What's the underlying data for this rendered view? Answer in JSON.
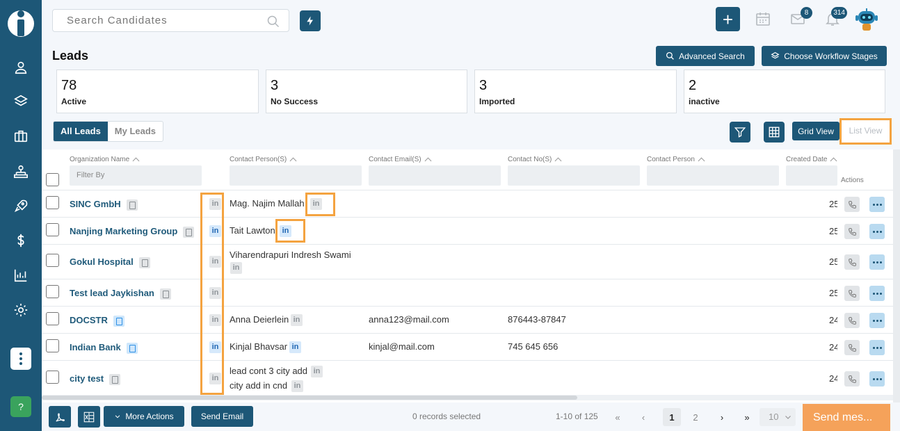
{
  "topbar": {
    "search_placeholder": "Search Candidates",
    "mail_badge": "8",
    "bell_badge": "314"
  },
  "page": {
    "title": "Leads",
    "advanced_search_label": "Advanced Search",
    "workflow_label": "Choose Workflow Stages"
  },
  "stats": [
    {
      "value": "78",
      "label": "Active"
    },
    {
      "value": "3",
      "label": "No Success"
    },
    {
      "value": "3",
      "label": "Imported"
    },
    {
      "value": "2",
      "label": "inactive"
    }
  ],
  "tabs": {
    "all": "All Leads",
    "mine": "My Leads"
  },
  "views": {
    "grid": "Grid View",
    "list": "List View"
  },
  "table": {
    "headers": {
      "org": "Organization Name",
      "contacts": "Contact Person(S)",
      "email": "Contact Email(S)",
      "phone": "Contact No(S)",
      "person": "Contact Person",
      "created": "Created Date",
      "actions": "Actions"
    },
    "filter_placeholder": "Filter By",
    "rows": [
      {
        "org": "SINC GmbH",
        "contact1": "Mag. Najim Mallah",
        "contact2": "",
        "email": "",
        "phone": "",
        "date": "25"
      },
      {
        "org": "Nanjing Marketing Group",
        "contact1": "Tait Lawton",
        "contact2": "",
        "email": "",
        "phone": "",
        "date": "25"
      },
      {
        "org": "Gokul Hospital",
        "contact1": "Viharendrapuri Indresh Swami",
        "contact2": "",
        "email": "",
        "phone": "",
        "date": "25"
      },
      {
        "org": "Test lead Jaykishan",
        "contact1": "",
        "contact2": "",
        "email": "",
        "phone": "",
        "date": "25"
      },
      {
        "org": "DOCSTR",
        "contact1": "Anna Deierlein",
        "contact2": "",
        "email": "anna123@mail.com",
        "phone": "876443-87847",
        "date": "24"
      },
      {
        "org": "Indian Bank",
        "contact1": "Kinjal Bhavsar",
        "contact2": "",
        "email": "kinjal@mail.com",
        "phone": "745 645 656",
        "date": "24"
      },
      {
        "org": "city test",
        "contact1": "lead cont 3 city add",
        "contact2": "city add in cnd",
        "email": "",
        "phone": "",
        "date": "24"
      }
    ]
  },
  "footer": {
    "more_actions": "More Actions",
    "send_email": "Send Email",
    "selected": "0 records selected",
    "range": "1-10 of 125",
    "page1": "1",
    "page2": "2",
    "page_size": "10",
    "send_message": "Send mes..."
  },
  "colors": {
    "primary": "#1d5777",
    "highlight": "#f4a340",
    "send_button": "#f5a25a",
    "link": "#1f5a7a"
  },
  "icons": [
    "user-icon",
    "layers-icon",
    "briefcase-icon",
    "org-chart-icon",
    "rocket-icon",
    "dollar-icon",
    "chart-icon",
    "gear-icon",
    "more-icon",
    "help-icon",
    "search-icon",
    "bolt-icon",
    "plus-icon",
    "calendar-icon",
    "mail-icon",
    "bell-icon",
    "bot-avatar-icon",
    "filter-icon",
    "grid-icon",
    "pdf-icon",
    "excel-icon",
    "phone-icon",
    "linkedin-icon",
    "document-icon"
  ]
}
